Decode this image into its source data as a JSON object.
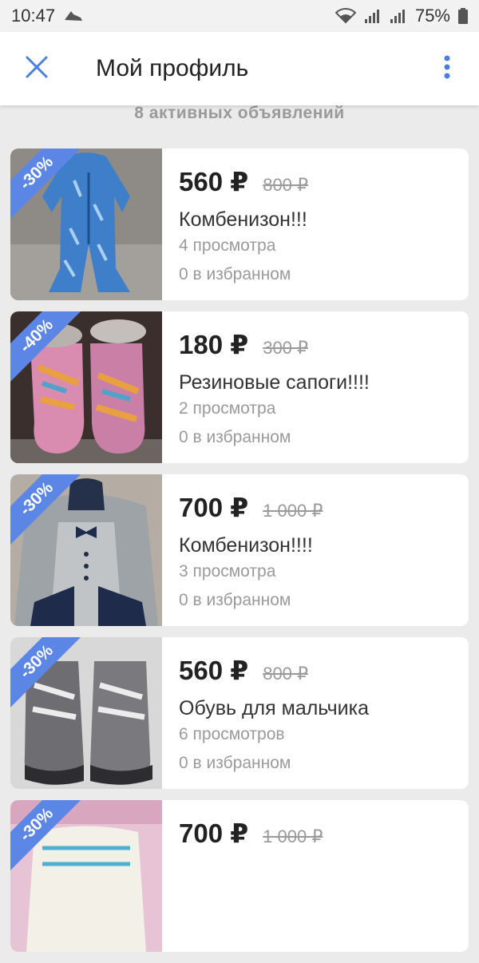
{
  "status_bar": {
    "time": "10:47",
    "battery": "75%"
  },
  "header": {
    "title": "Мой профиль"
  },
  "active_count": "8 активных объявлений",
  "listings": [
    {
      "discount": "-30%",
      "price": "560 ₽",
      "old_price": "800 ₽",
      "title": "Комбенизон!!!",
      "views": "4 просмотра",
      "favs": "0 в избранном"
    },
    {
      "discount": "-40%",
      "price": "180 ₽",
      "old_price": "300 ₽",
      "title": "Резиновые сапоги!!!!",
      "views": "2 просмотра",
      "favs": "0 в избранном"
    },
    {
      "discount": "-30%",
      "price": "700 ₽",
      "old_price": "1 000 ₽",
      "title": "Комбенизон!!!!",
      "views": "3 просмотра",
      "favs": "0 в избранном"
    },
    {
      "discount": "-30%",
      "price": "560 ₽",
      "old_price": "800 ₽",
      "title": "Обувь для мальчика",
      "views": "6 просмотров",
      "favs": "0 в избранном"
    },
    {
      "discount": "-30%",
      "price": "700 ₽",
      "old_price": "1 000 ₽"
    }
  ],
  "icons": {
    "close": "close-icon",
    "more": "more-vert-icon",
    "wifi": "wifi-icon",
    "signal": "signal-icon",
    "battery": "battery-icon",
    "app": "sneaker-icon"
  },
  "colors": {
    "accent": "#4a7fe0",
    "badge": "#5b86e6",
    "background": "#ebebeb"
  }
}
